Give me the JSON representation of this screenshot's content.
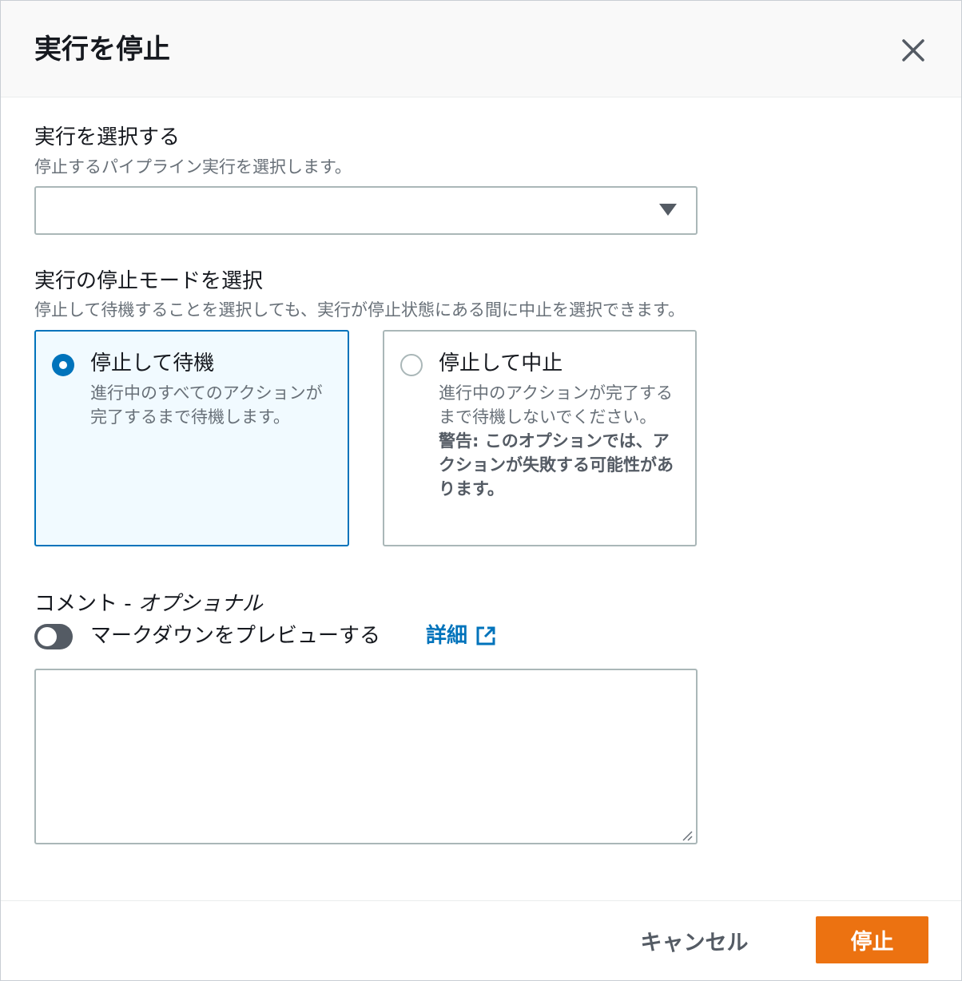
{
  "modal": {
    "title": "実行を停止",
    "close_icon": "close-icon"
  },
  "execution_select": {
    "label": "実行を選択する",
    "description": "停止するパイプライン実行を選択します。",
    "value": "",
    "caret_icon": "caret-down-icon"
  },
  "stop_mode": {
    "label": "実行の停止モードを選択",
    "description": "停止して待機することを選択しても、実行が停止状態にある間に中止を選択できます。",
    "options": [
      {
        "title": "停止して待機",
        "description": "進行中のすべてのアクションが完了するまで待機します。",
        "selected": true
      },
      {
        "title": "停止して中止",
        "description": "進行中のアクションが完了するまで待機しないでください。",
        "warning": "警告: このオプションでは、アクションが失敗する可能性があります。",
        "selected": false
      }
    ]
  },
  "comment": {
    "label": "コメント - ",
    "label_optional": "オプショナル",
    "toggle_label": "マークダウンをプレビューする",
    "toggle_on": false,
    "learn_more": "詳細",
    "external_link_icon": "external-link-icon",
    "value": ""
  },
  "footer": {
    "cancel_label": "キャンセル",
    "submit_label": "停止"
  },
  "colors": {
    "accent": "#0073bb",
    "primary_button": "#ec7211",
    "header_bg": "#f9f9f9",
    "selected_card_bg": "#f1faff"
  }
}
